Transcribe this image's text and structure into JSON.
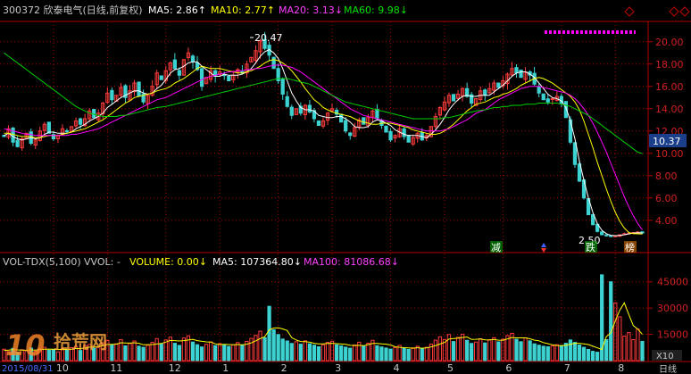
{
  "header": {
    "title": "300372 欣泰电气(日线,前复权)",
    "ma5": "MA5: 2.86↑",
    "ma10": "MA10: 2.77↑",
    "ma20": "MA20: 3.13↓",
    "ma60": "MA60: 9.98↓"
  },
  "volume_header": {
    "title": "VOL-TDX(5,100)",
    "vvol": "VVOL: -",
    "volume": "VOLUME: 0.00↓",
    "ma5": "MA5: 107364.80↓",
    "ma100": "MA100: 81086.68↓"
  },
  "annotations": {
    "high_label": "20.47",
    "low_label": "2.50",
    "current_price": "10.37",
    "scale_label": "X10",
    "period_label": "日线",
    "date_label": "2015/08/31",
    "tag_reduce": "减",
    "tag_fall": "跌",
    "tag_list": "榜",
    "watermark_num": "10",
    "watermark_text": "拾荒网"
  },
  "colors": {
    "up": "#ff3c3c",
    "down": "#3cd2d2",
    "ma5": "#ffffff",
    "ma10": "#ffff00",
    "ma20": "#ff00ff",
    "ma60": "#00d000",
    "axis": "#b00000"
  },
  "chart_data": [
    {
      "type": "candlestick",
      "title": "300372 欣泰电气(日线,前复权)",
      "ylim": [
        1.5,
        21.5
      ],
      "yticks": [
        "20.00",
        "18.00",
        "16.00",
        "14.00",
        "12.00",
        "10.00",
        "8.00",
        "6.00",
        "4.00"
      ],
      "ytick_values": [
        20,
        18,
        16,
        14,
        12,
        10,
        8,
        6,
        4
      ],
      "xticks": [
        "10",
        "11",
        "12",
        "1",
        "2",
        "3",
        "4",
        "5",
        "6",
        "7",
        "8"
      ],
      "close": [
        11.5,
        12.2,
        11.0,
        10.6,
        11.3,
        11.8,
        10.9,
        11.2,
        12.0,
        12.6,
        11.8,
        11.3,
        11.6,
        12.2,
        12.0,
        12.4,
        12.9,
        12.6,
        13.1,
        13.8,
        13.2,
        13.6,
        14.5,
        15.4,
        14.8,
        15.2,
        15.9,
        15.0,
        15.6,
        16.3,
        15.1,
        14.6,
        15.2,
        16.0,
        17.2,
        16.6,
        17.4,
        18.1,
        17.6,
        17.0,
        18.4,
        19.0,
        18.2,
        17.5,
        16.0,
        16.8,
        17.4,
        16.9,
        17.3,
        17.0,
        16.5,
        17.0,
        17.5,
        17.2,
        18.0,
        18.6,
        19.2,
        20.1,
        19.4,
        18.8,
        17.6,
        16.5,
        15.3,
        14.2,
        13.4,
        14.0,
        13.6,
        14.3,
        13.7,
        13.1,
        12.5,
        12.9,
        13.6,
        14.0,
        13.5,
        12.8,
        12.0,
        11.6,
        12.3,
        13.0,
        12.6,
        13.2,
        13.8,
        13.1,
        12.5,
        11.9,
        11.2,
        11.6,
        12.2,
        11.5,
        11.0,
        11.4,
        11.8,
        11.2,
        11.6,
        12.4,
        13.3,
        14.1,
        14.6,
        15.2,
        14.7,
        15.3,
        15.8,
        15.1,
        14.5,
        14.9,
        15.6,
        15.2,
        15.8,
        16.3,
        15.9,
        16.5,
        17.1,
        17.6,
        17.2,
        16.8,
        17.3,
        17.0,
        16.2,
        15.4,
        14.8,
        14.6,
        14.9,
        15.1,
        14.5,
        13.2,
        11.0,
        9.0,
        7.5,
        6.0,
        4.5,
        3.6,
        3.0,
        2.7,
        2.6,
        2.55,
        2.6,
        2.7,
        2.8,
        2.85,
        2.9,
        2.95,
        2.86
      ],
      "ma5": [
        11.6,
        11.8,
        11.5,
        11.3,
        11.2,
        11.3,
        11.4,
        11.3,
        11.4,
        11.7,
        11.9,
        11.9,
        11.8,
        11.8,
        11.8,
        11.9,
        12.2,
        12.4,
        12.6,
        12.9,
        13.1,
        13.3,
        13.6,
        14.1,
        14.4,
        14.7,
        15.0,
        15.2,
        15.4,
        15.6,
        15.6,
        15.4,
        15.3,
        15.4,
        15.8,
        16.1,
        16.6,
        17.2,
        17.5,
        17.6,
        17.8,
        18.1,
        18.2,
        18.2,
        17.8,
        17.5,
        17.2,
        16.9,
        16.9,
        17.1,
        17.0,
        17.0,
        17.0,
        17.1,
        17.3,
        17.6,
        18.1,
        18.7,
        19.1,
        19.3,
        19.0,
        18.5,
        17.6,
        16.5,
        15.4,
        14.7,
        14.1,
        13.9,
        13.9,
        13.8,
        13.4,
        13.3,
        13.2,
        13.2,
        13.3,
        13.3,
        13.1,
        12.8,
        12.4,
        12.3,
        12.3,
        12.4,
        12.8,
        13.0,
        12.9,
        12.7,
        12.5,
        12.1,
        11.9,
        11.7,
        11.6,
        11.6,
        11.6,
        11.5,
        11.4,
        11.7,
        12.1,
        12.6,
        13.2,
        13.9,
        14.4,
        14.8,
        15.1,
        15.2,
        15.1,
        15.1,
        15.2,
        15.2,
        15.2,
        15.5,
        15.8,
        16.1,
        16.5,
        16.9,
        17.2,
        17.3,
        17.3,
        17.1,
        16.8,
        16.3,
        15.8,
        15.3,
        15.0,
        14.9,
        14.7,
        14.1,
        12.9,
        11.3,
        9.3,
        7.6,
        6.0,
        4.7,
        3.7,
        3.1,
        2.8,
        2.65,
        2.62,
        2.64,
        2.7,
        2.78,
        2.85,
        2.88,
        2.86
      ],
      "ma10": [
        11.8,
        11.8,
        11.7,
        11.6,
        11.5,
        11.5,
        11.5,
        11.4,
        11.4,
        11.5,
        11.6,
        11.6,
        11.6,
        11.7,
        11.8,
        11.9,
        12.0,
        12.1,
        12.2,
        12.4,
        12.6,
        12.8,
        13.0,
        13.3,
        13.6,
        13.9,
        14.2,
        14.5,
        14.7,
        15.0,
        15.1,
        15.2,
        15.3,
        15.4,
        15.6,
        15.8,
        16.0,
        16.3,
        16.5,
        16.7,
        17.0,
        17.3,
        17.6,
        17.8,
        17.7,
        17.6,
        17.6,
        17.6,
        17.5,
        17.4,
        17.3,
        17.2,
        17.2,
        17.3,
        17.4,
        17.6,
        17.8,
        18.1,
        18.3,
        18.4,
        18.3,
        18.1,
        17.8,
        17.4,
        16.9,
        16.4,
        15.8,
        15.3,
        14.8,
        14.5,
        14.1,
        13.9,
        13.7,
        13.6,
        13.5,
        13.4,
        13.3,
        13.1,
        12.9,
        12.8,
        12.7,
        12.6,
        12.6,
        12.7,
        12.7,
        12.7,
        12.6,
        12.5,
        12.4,
        12.3,
        12.1,
        12.0,
        11.9,
        11.8,
        11.7,
        11.7,
        11.8,
        12.0,
        12.3,
        12.6,
        13.0,
        13.4,
        13.8,
        14.1,
        14.4,
        14.6,
        14.8,
        15.0,
        15.1,
        15.3,
        15.4,
        15.6,
        15.8,
        16.1,
        16.3,
        16.5,
        16.7,
        16.8,
        16.7,
        16.5,
        16.3,
        16.0,
        15.7,
        15.4,
        15.1,
        14.6,
        13.9,
        12.9,
        11.7,
        10.5,
        9.2,
        8.0,
        6.8,
        5.7,
        4.7,
        3.9,
        3.3,
        2.9,
        2.8,
        2.78,
        2.77
      ],
      "ma20": [
        12.2,
        12.1,
        12.0,
        11.9,
        11.8,
        11.7,
        11.7,
        11.6,
        11.6,
        11.6,
        11.6,
        11.6,
        11.6,
        11.6,
        11.6,
        11.7,
        11.7,
        11.8,
        11.9,
        12.0,
        12.1,
        12.2,
        12.4,
        12.6,
        12.8,
        13.0,
        13.2,
        13.4,
        13.6,
        13.8,
        14.0,
        14.2,
        14.4,
        14.6,
        14.8,
        15.0,
        15.2,
        15.4,
        15.6,
        15.8,
        16.0,
        16.2,
        16.4,
        16.6,
        16.8,
        16.9,
        17.0,
        17.1,
        17.2,
        17.3,
        17.3,
        17.4,
        17.4,
        17.5,
        17.5,
        17.6,
        17.6,
        17.7,
        17.8,
        17.9,
        17.9,
        17.9,
        17.8,
        17.7,
        17.5,
        17.3,
        17.0,
        16.7,
        16.4,
        16.1,
        15.8,
        15.5,
        15.2,
        14.9,
        14.6,
        14.3,
        14.0,
        13.8,
        13.6,
        13.4,
        13.3,
        13.2,
        13.1,
        13.0,
        12.9,
        12.8,
        12.7,
        12.6,
        12.5,
        12.4,
        12.3,
        12.2,
        12.1,
        12.0,
        12.0,
        12.0,
        12.0,
        12.1,
        12.2,
        12.4,
        12.6,
        12.8,
        13.0,
        13.3,
        13.6,
        13.9,
        14.2,
        14.5,
        14.8,
        15.0,
        15.2,
        15.4,
        15.6,
        15.8,
        15.9,
        16.0,
        16.0,
        16.0,
        15.9,
        15.8,
        15.7,
        15.6,
        15.5,
        15.4,
        15.2,
        14.9,
        14.5,
        14.0,
        13.4,
        12.7,
        11.9,
        11.0,
        10.1,
        9.1,
        8.1,
        7.1,
        6.1,
        5.2,
        4.4,
        3.7,
        3.13
      ],
      "ma60": [
        19.0,
        18.7,
        18.4,
        18.1,
        17.8,
        17.5,
        17.2,
        16.9,
        16.6,
        16.3,
        16.0,
        15.7,
        15.4,
        15.1,
        14.8,
        14.5,
        14.2,
        14.0,
        13.8,
        13.6,
        13.5,
        13.4,
        13.3,
        13.3,
        13.3,
        13.3,
        13.4,
        13.4,
        13.5,
        13.6,
        13.7,
        13.8,
        13.9,
        14.0,
        14.1,
        14.2,
        14.3,
        14.4,
        14.5,
        14.6,
        14.7,
        14.8,
        14.9,
        15.0,
        15.1,
        15.2,
        15.3,
        15.4,
        15.5,
        15.6,
        15.7,
        15.8,
        15.9,
        16.0,
        16.1,
        16.2,
        16.3,
        16.4,
        16.5,
        16.6,
        16.7,
        16.7,
        16.7,
        16.6,
        16.5,
        16.4,
        16.3,
        16.2,
        16.0,
        15.8,
        15.6,
        15.4,
        15.2,
        15.0,
        14.8,
        14.6,
        14.5,
        14.4,
        14.3,
        14.2,
        14.1,
        14.0,
        13.9,
        13.8,
        13.7,
        13.6,
        13.5,
        13.4,
        13.3,
        13.2,
        13.1,
        13.1,
        13.1,
        13.1,
        13.1,
        13.1,
        13.1,
        13.2,
        13.2,
        13.3,
        13.4,
        13.5,
        13.6,
        13.7,
        13.8,
        13.9,
        14.0,
        14.1,
        14.1,
        14.2,
        14.2,
        14.3,
        14.3,
        14.3,
        14.4,
        14.4,
        14.4,
        14.5,
        14.5,
        14.5,
        14.5,
        14.5,
        14.4,
        14.3,
        14.2,
        14.0,
        13.8,
        13.6,
        13.4,
        13.1,
        12.8,
        12.5,
        12.2,
        11.9,
        11.6,
        11.3,
        11.0,
        10.7,
        10.4,
        10.1,
        9.98
      ]
    },
    {
      "type": "bar",
      "title": "VOL-TDX(5,100)",
      "ylim": [
        0,
        52000
      ],
      "yticks": [
        "45000",
        "30000",
        "15000"
      ],
      "ytick_values": [
        45000,
        30000,
        15000
      ],
      "volume": [
        6500,
        5200,
        7000,
        4800,
        6200,
        5600,
        7200,
        5400,
        6800,
        7600,
        5900,
        6100,
        5000,
        6900,
        6200,
        7400,
        8100,
        5800,
        8600,
        9200,
        7100,
        8000,
        10200,
        11500,
        8900,
        9600,
        12000,
        8400,
        9800,
        11200,
        8200,
        7600,
        8800,
        10400,
        12600,
        9400,
        11800,
        13400,
        9900,
        8700,
        12900,
        14200,
        10600,
        9100,
        7800,
        9300,
        10700,
        8600,
        9700,
        8900,
        8100,
        9000,
        10300,
        8800,
        11000,
        12700,
        14400,
        16800,
        13100,
        31000,
        17600,
        14900,
        12300,
        11200,
        9800,
        10800,
        9400,
        11300,
        9600,
        8800,
        7900,
        9100,
        10400,
        11100,
        9000,
        8400,
        7700,
        7100,
        8900,
        10500,
        8300,
        9900,
        11600,
        8500,
        7800,
        7200,
        6600,
        7500,
        8700,
        7000,
        6400,
        7300,
        8200,
        6800,
        7600,
        9400,
        11700,
        13600,
        12100,
        14900,
        10900,
        13300,
        15100,
        11600,
        9800,
        10600,
        12500,
        10100,
        11900,
        13100,
        10700,
        12300,
        14300,
        15600,
        12200,
        10800,
        12900,
        11300,
        9600,
        8800,
        8200,
        7900,
        8400,
        9100,
        8600,
        9900,
        11800,
        10400,
        8900,
        7600,
        6400,
        5300,
        4800,
        49000,
        12000,
        45000,
        33000,
        25000,
        14000,
        16000,
        12000,
        18000,
        11000,
        10000
      ],
      "ma5": [
        5800,
        6000,
        6300,
        6100,
        6000,
        5900,
        6100,
        6000,
        6300,
        6500,
        6600,
        6500,
        6300,
        6400,
        6300,
        6500,
        6900,
        6900,
        7200,
        7700,
        7800,
        7800,
        8600,
        9200,
        9300,
        9400,
        10200,
        10100,
        10000,
        10200,
        9900,
        9000,
        9100,
        9200,
        9500,
        9800,
        10600,
        11500,
        11400,
        11200,
        11400,
        11800,
        12200,
        11400,
        11000,
        10700,
        10600,
        9600,
        9100,
        9300,
        9200,
        9000,
        9200,
        9000,
        9400,
        10100,
        11300,
        12600,
        13600,
        17600,
        18600,
        18700,
        18100,
        17200,
        13100,
        11800,
        10900,
        10800,
        10500,
        9900,
        9600,
        9600,
        9800,
        9900,
        9700,
        9500,
        9300,
        8700,
        8600,
        8700,
        8500,
        9100,
        9800,
        9800,
        9600,
        9400,
        8900,
        7900,
        7600,
        7400,
        7300,
        7100,
        7400,
        7100,
        7300,
        7800,
        8600,
        9500,
        10400,
        12300,
        12600,
        12800,
        13200,
        13500,
        12100,
        12200,
        12400,
        11900,
        11800,
        12100,
        11700,
        11600,
        12400,
        13200,
        13000,
        13000,
        13000,
        12500,
        11700,
        11300,
        10300,
        9700,
        9000,
        8600,
        8500,
        8700,
        9300,
        9900,
        9900,
        9600,
        9200,
        8200,
        7300,
        6300,
        13700,
        15800,
        22800,
        28900,
        33000,
        26200,
        20000,
        18000,
        15000,
        14000,
        12000
      ]
    }
  ]
}
